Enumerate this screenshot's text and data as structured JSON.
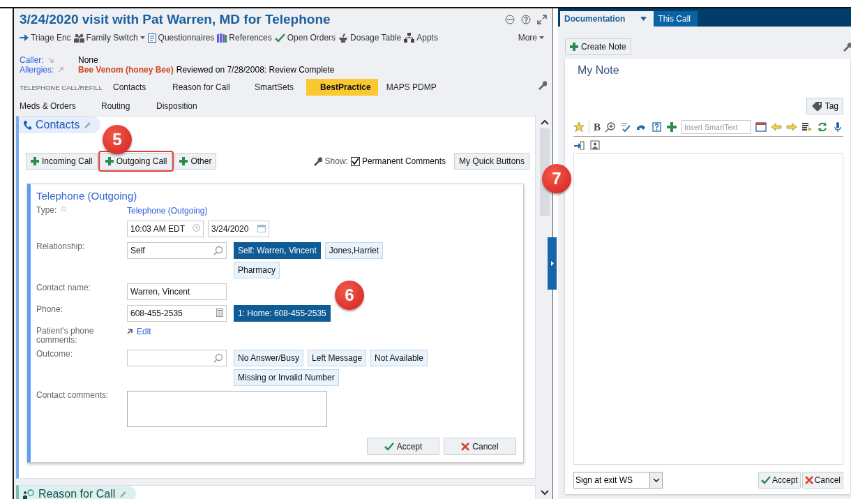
{
  "visit": {
    "title": "3/24/2020 visit with Pat Warren, MD for Telephone",
    "toolbar": [
      {
        "label": "Triage Enc",
        "dropdown": false
      },
      {
        "label": "Family Switch",
        "dropdown": true
      },
      {
        "label": "Questionnaires",
        "dropdown": false
      },
      {
        "label": "References",
        "dropdown": false
      },
      {
        "label": "Open Orders",
        "dropdown": false
      },
      {
        "label": "Dosage Table",
        "dropdown": false
      },
      {
        "label": "Appts",
        "dropdown": false
      }
    ],
    "more": "More",
    "caller": {
      "label": "Caller:",
      "value": "None"
    },
    "allergies": {
      "label": "Allergies:",
      "allergen": "Bee Venom (honey Bee)",
      "status": "Reviewed on 7/28/2008: Review Complete"
    },
    "section_label": "TELEPHONE CALL/REFILL",
    "tabs": [
      {
        "label": "Contacts",
        "selected": false
      },
      {
        "label": "Reason for Call",
        "selected": false
      },
      {
        "label": "SmartSets",
        "selected": false
      },
      {
        "label": "BestPractice",
        "selected": true
      },
      {
        "label": "MAPS PDMP",
        "selected": false
      },
      {
        "label": "Meds & Orders",
        "selected": false
      },
      {
        "label": "Routing",
        "selected": false
      },
      {
        "label": "Disposition",
        "selected": false
      }
    ],
    "contacts": {
      "title": "Contacts",
      "buttons": [
        {
          "label": "Incoming Call",
          "highlighted": false
        },
        {
          "label": "Outgoing Call",
          "highlighted": true
        },
        {
          "label": "Other",
          "highlighted": false
        }
      ],
      "show_label": "Show:",
      "permanent_comments": {
        "label": "Permanent Comments",
        "checked": true
      },
      "quick_buttons": "My Quick Buttons",
      "form": {
        "title": "Telephone (Outgoing)",
        "type_label": "Type:",
        "type_value": "Telephone (Outgoing)",
        "time": "10:03 AM EDT",
        "date": "3/24/2020",
        "relationship": {
          "label": "Relationship:",
          "value": "Self",
          "options": [
            {
              "label": "Self: Warren, Vincent",
              "selected": true
            },
            {
              "label": "Jones,Harriet",
              "selected": false
            },
            {
              "label": "Pharmacy",
              "selected": false
            }
          ]
        },
        "contact_name": {
          "label": "Contact name:",
          "value": "Warren, Vincent"
        },
        "phone": {
          "label": "Phone:",
          "value": "608-455-2535",
          "options": [
            {
              "label": "1: Home: 608-455-2535",
              "selected": true
            }
          ]
        },
        "phone_comments": {
          "label": "Patient's phone comments:",
          "link": "Edit"
        },
        "outcome": {
          "label": "Outcome:",
          "options": [
            {
              "label": "No Answer/Busy",
              "selected": false
            },
            {
              "label": "Left Message",
              "selected": false
            },
            {
              "label": "Not Available",
              "selected": false
            },
            {
              "label": "Missing or Invalid Number",
              "selected": false
            }
          ]
        },
        "contact_comments": {
          "label": "Contact comments:"
        },
        "accept": "Accept",
        "cancel": "Cancel"
      }
    },
    "reason_for_call": {
      "title": "Reason for Call"
    }
  },
  "documentation": {
    "tabs": [
      {
        "label": "Documentation",
        "selected": true
      },
      {
        "label": "This Call",
        "selected": false
      }
    ],
    "create_note": "Create Note",
    "note_title": "My Note",
    "tag": "Tag",
    "bold": "B",
    "smarttext_placeholder": "Insert SmartText",
    "sign_option": "Sign at exit WS",
    "accept": "Accept",
    "cancel": "Cancel"
  },
  "callouts": [
    {
      "number": "5"
    },
    {
      "number": "6"
    },
    {
      "number": "7"
    }
  ]
}
